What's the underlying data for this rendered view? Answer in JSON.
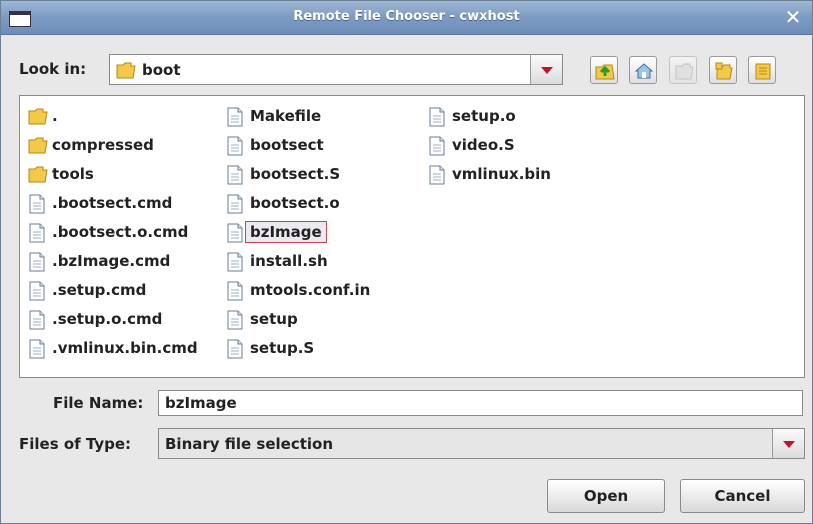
{
  "window": {
    "title": "Remote File Chooser - cwxhost"
  },
  "look_in": {
    "label": "Look in:",
    "value": "boot"
  },
  "toolbar": {
    "icons": [
      "up-folder-icon",
      "home-icon",
      "new-folder-icon",
      "list-view-icon",
      "details-view-icon"
    ]
  },
  "files": {
    "columns": [
      [
        {
          "name": ".",
          "type": "folder"
        },
        {
          "name": "compressed",
          "type": "folder"
        },
        {
          "name": "tools",
          "type": "folder"
        },
        {
          "name": ".bootsect.cmd",
          "type": "file"
        },
        {
          "name": ".bootsect.o.cmd",
          "type": "file"
        },
        {
          "name": ".bzImage.cmd",
          "type": "file"
        },
        {
          "name": ".setup.cmd",
          "type": "file"
        },
        {
          "name": ".setup.o.cmd",
          "type": "file"
        },
        {
          "name": ".vmlinux.bin.cmd",
          "type": "file"
        }
      ],
      [
        {
          "name": "Makefile",
          "type": "file"
        },
        {
          "name": "bootsect",
          "type": "file"
        },
        {
          "name": "bootsect.S",
          "type": "file"
        },
        {
          "name": "bootsect.o",
          "type": "file"
        },
        {
          "name": "bzImage",
          "type": "file",
          "selected": true
        },
        {
          "name": "install.sh",
          "type": "file"
        },
        {
          "name": "mtools.conf.in",
          "type": "file"
        },
        {
          "name": "setup",
          "type": "file"
        },
        {
          "name": "setup.S",
          "type": "file"
        }
      ],
      [
        {
          "name": "setup.o",
          "type": "file"
        },
        {
          "name": "video.S",
          "type": "file"
        },
        {
          "name": "vmlinux.bin",
          "type": "file"
        }
      ]
    ]
  },
  "file_name": {
    "label": "File Name:",
    "value": "bzImage"
  },
  "file_type": {
    "label": "Files of Type:",
    "value": "Binary file selection"
  },
  "buttons": {
    "open": "Open",
    "cancel": "Cancel"
  },
  "colors": {
    "titlebar": "#7e9cc3",
    "selection_border": "#c9464f",
    "combo_arrow": "#c4102a"
  }
}
